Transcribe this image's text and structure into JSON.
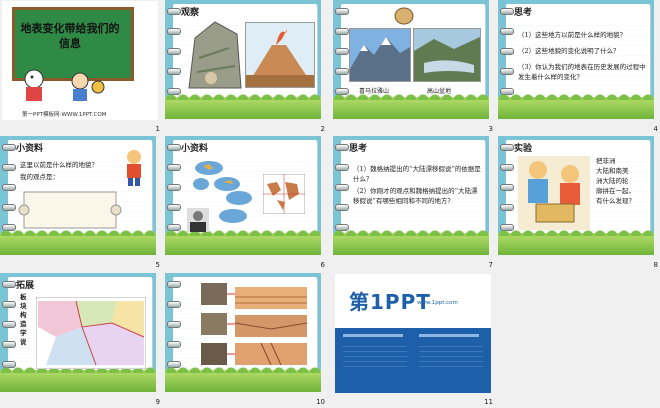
{
  "slides": [
    {
      "number": "1",
      "title": "地表变化带给我们的信息",
      "footer": "第一PPT模板网-WWW.1PPT.COM"
    },
    {
      "number": "2",
      "heading": "观察"
    },
    {
      "number": "3",
      "captions": [
        "喜马拉雅山",
        "高山盆地"
      ]
    },
    {
      "number": "4",
      "heading": "思考",
      "lines": [
        "（1）这些地方以前是什么样的地貌？",
        "（2）这些地貌的变化说明了什么？",
        "（3）你认为我们的地表在历史发展的过程中发生着什么样的变化？"
      ]
    },
    {
      "number": "5",
      "heading": "小资料",
      "lines": [
        "这里以前是什么样的地貌？",
        "我的观点是："
      ]
    },
    {
      "number": "6",
      "heading": "小资料"
    },
    {
      "number": "7",
      "heading": "思考",
      "lines": [
        "（1）魏格纳提出的“大陆漂移假说”的依据是什么？",
        "（2）你刚才的观点和魏格纳提出的“大陆漂移假说”有哪些相同和不同的地方？"
      ]
    },
    {
      "number": "8",
      "heading": "实验",
      "lines": [
        "把非洲",
        "大陆和南美",
        "洲大陆的轮",
        "廓拼在一起，",
        "有什么发现？"
      ]
    },
    {
      "number": "9",
      "heading": "拓展",
      "side": "板块构造学说"
    },
    {
      "number": "10"
    },
    {
      "number": "11",
      "brand": "第1PPT",
      "url": "www.1ppt.com"
    }
  ],
  "colors": {
    "teal": "#7bc4d6",
    "board": "#3a8a4a",
    "brand_blue": "#1d5fa8",
    "brand_red": "#d8262a"
  }
}
